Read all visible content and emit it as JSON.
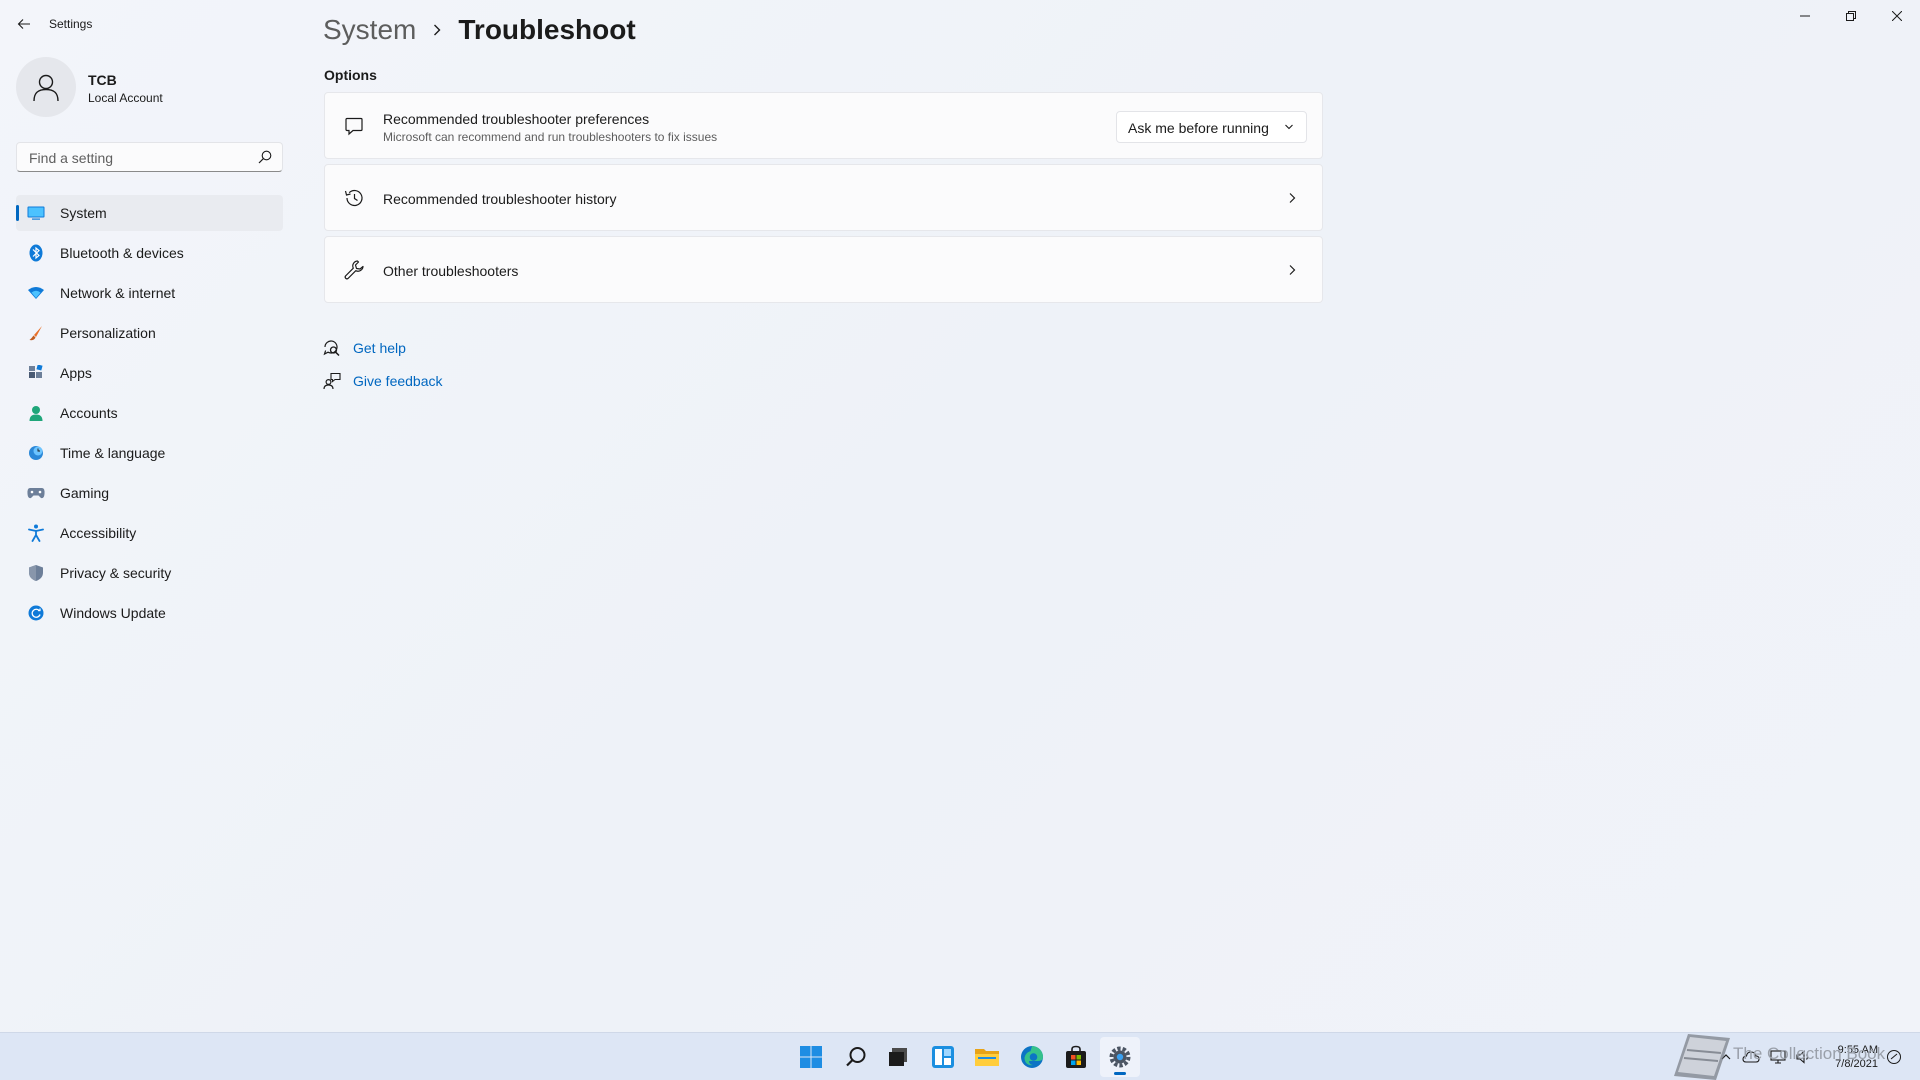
{
  "app": {
    "title": "Settings"
  },
  "account": {
    "name": "TCB",
    "type": "Local Account"
  },
  "search": {
    "placeholder": "Find a setting"
  },
  "sidebar": {
    "items": [
      {
        "label": "System",
        "icon": "monitor-icon",
        "active": true
      },
      {
        "label": "Bluetooth & devices",
        "icon": "bluetooth-icon"
      },
      {
        "label": "Network & internet",
        "icon": "wifi-icon"
      },
      {
        "label": "Personalization",
        "icon": "brush-icon"
      },
      {
        "label": "Apps",
        "icon": "apps-icon"
      },
      {
        "label": "Accounts",
        "icon": "person-icon"
      },
      {
        "label": "Time & language",
        "icon": "globe-clock-icon"
      },
      {
        "label": "Gaming",
        "icon": "gamepad-icon"
      },
      {
        "label": "Accessibility",
        "icon": "accessibility-icon"
      },
      {
        "label": "Privacy & security",
        "icon": "shield-icon"
      },
      {
        "label": "Windows Update",
        "icon": "update-icon"
      }
    ]
  },
  "breadcrumb": {
    "parent": "System",
    "current": "Troubleshoot"
  },
  "options": {
    "title": "Options",
    "cards": [
      {
        "title": "Recommended troubleshooter preferences",
        "subtitle": "Microsoft can recommend and run troubleshooters to fix issues",
        "dropdown_value": "Ask me before running",
        "icon": "chat-bubble-icon"
      },
      {
        "title": "Recommended troubleshooter history",
        "icon": "history-icon"
      },
      {
        "title": "Other troubleshooters",
        "icon": "wrench-icon"
      }
    ]
  },
  "help_links": {
    "get_help": "Get help",
    "give_feedback": "Give feedback"
  },
  "taskbar": {
    "apps": [
      "start-icon",
      "search-icon",
      "task-view-icon",
      "widgets-icon",
      "file-explorer-icon",
      "edge-icon",
      "store-icon",
      "settings-icon"
    ],
    "active_app": "settings-icon"
  },
  "tray": {
    "time": "9:55 AM",
    "date": "7/8/2021"
  },
  "watermark": {
    "text": "The Collection Book"
  },
  "colors": {
    "accent": "#0067c0",
    "background": "#f3f5fa",
    "card": "#fbfbfc"
  }
}
